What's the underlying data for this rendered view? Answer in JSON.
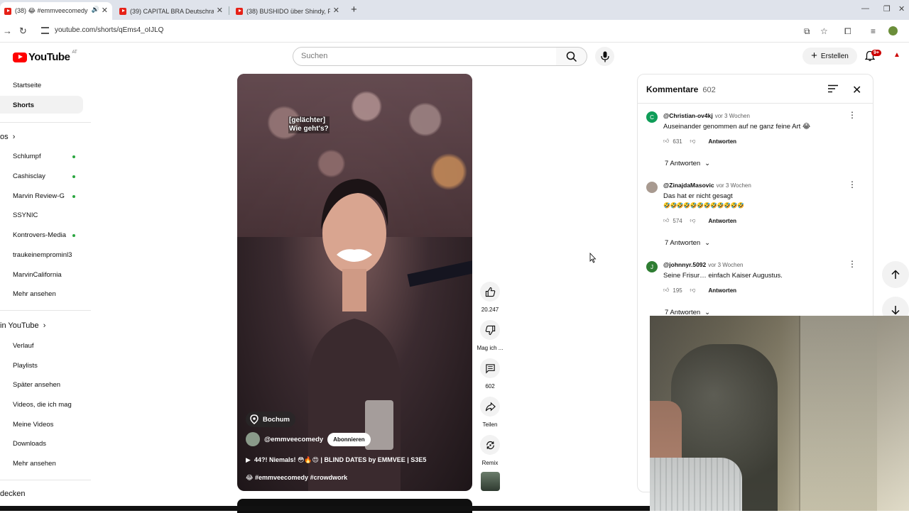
{
  "browser": {
    "tabs": [
      {
        "title": "(38) 😂 #emmveecomedy",
        "active": true
      },
      {
        "title": "(39) CAPITAL BRA Deutschrap N",
        "active": false
      },
      {
        "title": "(38) BUSHIDO über Shindy, Fle",
        "active": false
      }
    ],
    "url": "youtube.com/shorts/qEms4_oIJLQ"
  },
  "header": {
    "logo_text": "YouTube",
    "country": "AT",
    "search_placeholder": "Suchen",
    "create_label": "Erstellen",
    "notification_badge": "9+"
  },
  "sidebar": {
    "top": [
      {
        "label": "Startseite"
      },
      {
        "label": "Shorts",
        "selected": true
      }
    ],
    "subs_heading": "os",
    "subscriptions": [
      {
        "label": "Schlumpf",
        "dot": true
      },
      {
        "label": "Cashisclay",
        "dot": true
      },
      {
        "label": "Marvin Review-G",
        "dot": true
      },
      {
        "label": "SSYNIC",
        "dot": false
      },
      {
        "label": "Kontrovers-Media",
        "dot": true
      },
      {
        "label": "traukeinemprominl3",
        "dot": false
      },
      {
        "label": "MarvinCalifornia",
        "dot": false
      },
      {
        "label": "Mehr ansehen",
        "dot": false
      }
    ],
    "you_heading": "in YouTube",
    "you_items": [
      {
        "label": "Verlauf"
      },
      {
        "label": "Playlists"
      },
      {
        "label": "Später ansehen"
      },
      {
        "label": "Videos, die ich mag"
      },
      {
        "label": "Meine Videos"
      },
      {
        "label": "Downloads"
      },
      {
        "label": "Mehr ansehen"
      }
    ],
    "discover_heading": "decken"
  },
  "video": {
    "caption_line1": "[gelächter]",
    "caption_line2": "Wie geht's?",
    "location": "Bochum",
    "channel": "@emmveecomedy",
    "subscribe_label": "Abonnieren",
    "title": "44?! Niemals! 😳🔥😍 | BLIND DATES by EMMVEE | S3E5",
    "tags": "😂 #emmveecomedy #crowdwork"
  },
  "actions": {
    "likes": "20.247",
    "dislike_label": "Mag ich ...",
    "comments": "602",
    "share_label": "Teilen",
    "remix_label": "Remix"
  },
  "comments": {
    "heading": "Kommentare",
    "count": "602",
    "items": [
      {
        "user": "@Christian-ov4kj",
        "when": "vor 3 Wochen",
        "text": "Auseinander genommen auf ne ganz feine Art 😂",
        "extra": "",
        "likes": "631",
        "reply_label": "Antworten",
        "replies": "7 Antworten",
        "avatar_letter": "C",
        "avatar_color": "#0f9d58"
      },
      {
        "user": "@ZinajdaMasovic",
        "when": "vor 3 Wochen",
        "text": "Das hat er nicht gesagt",
        "extra": "🤣🤣🤣🤣🤣🤣🤣🤣🤣🤣🤣🤣",
        "likes": "574",
        "reply_label": "Antworten",
        "replies": "7 Antworten",
        "avatar_letter": "",
        "avatar_color": "#a89a90"
      },
      {
        "user": "@johnnyr.5092",
        "when": "vor 3 Wochen",
        "text": "Seine Frisur… einfach Kaiser Augustus.",
        "extra": "",
        "likes": "195",
        "reply_label": "Antworten",
        "replies": "7 Antworten",
        "avatar_letter": "J",
        "avatar_color": "#2e7d32"
      }
    ]
  }
}
